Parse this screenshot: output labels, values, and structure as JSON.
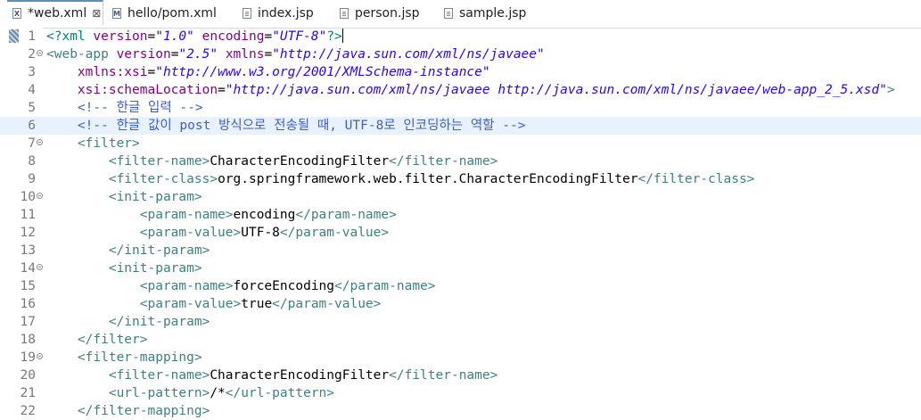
{
  "tabs": [
    {
      "label": "*web.xml",
      "icon": "xml-file-icon",
      "active": true,
      "close": "⊠"
    },
    {
      "label": "hello/pom.xml",
      "icon": "maven-file-icon",
      "active": false
    },
    {
      "label": "index.jsp",
      "icon": "jsp-file-icon",
      "active": false
    },
    {
      "label": "person.jsp",
      "icon": "jsp-file-icon",
      "active": false
    },
    {
      "label": "sample.jsp",
      "icon": "jsp-file-icon",
      "active": false
    }
  ],
  "icons": {
    "xml": "X",
    "maven": "M"
  },
  "lines": [
    {
      "n": "1",
      "p": [
        {
          "c": "decl",
          "t": "<?xml "
        },
        {
          "c": "attr",
          "t": "version"
        },
        {
          "c": "txt",
          "t": "="
        },
        {
          "c": "val",
          "t": "\"1.0\""
        },
        {
          "c": "txt",
          "t": " "
        },
        {
          "c": "attr",
          "t": "encoding"
        },
        {
          "c": "txt",
          "t": "="
        },
        {
          "c": "val",
          "t": "\"UTF-8\""
        },
        {
          "c": "decl",
          "t": "?>"
        }
      ]
    },
    {
      "n": "2",
      "p": [
        {
          "c": "tag",
          "t": "<web-app "
        },
        {
          "c": "attr",
          "t": "version"
        },
        {
          "c": "txt",
          "t": "="
        },
        {
          "c": "val",
          "t": "\"2.5\""
        },
        {
          "c": "txt",
          "t": " "
        },
        {
          "c": "attr",
          "t": "xmlns"
        },
        {
          "c": "txt",
          "t": "="
        },
        {
          "c": "val",
          "t": "\"http://java.sun.com/xml/ns/javaee\""
        }
      ]
    },
    {
      "n": "3",
      "p": [
        {
          "c": "txt",
          "t": "    "
        },
        {
          "c": "attr",
          "t": "xmlns:xsi"
        },
        {
          "c": "txt",
          "t": "="
        },
        {
          "c": "val",
          "t": "\"http://www.w3.org/2001/XMLSchema-instance\""
        }
      ]
    },
    {
      "n": "4",
      "p": [
        {
          "c": "txt",
          "t": "    "
        },
        {
          "c": "attr",
          "t": "xsi:schemaLocation"
        },
        {
          "c": "txt",
          "t": "="
        },
        {
          "c": "val",
          "t": "\"http://java.sun.com/xml/ns/javaee http://java.sun.com/xml/ns/javaee/web-app_2_5.xsd\""
        },
        {
          "c": "tag",
          "t": ">"
        }
      ]
    },
    {
      "n": "5",
      "p": [
        {
          "c": "cmt",
          "t": "    <!-- 한글 입력 -->"
        }
      ]
    },
    {
      "n": "6",
      "p": [
        {
          "c": "cmt",
          "t": "    <!-- 한글 값이 post 방식으로 전송될 때, UTF-8로 인코딩하는 역할 -->"
        }
      ]
    },
    {
      "n": "7",
      "p": [
        {
          "c": "tag",
          "t": "    <filter>"
        }
      ]
    },
    {
      "n": "8",
      "p": [
        {
          "c": "tag",
          "t": "        <filter-name>"
        },
        {
          "c": "txt",
          "t": "CharacterEncodingFilter"
        },
        {
          "c": "tag",
          "t": "</filter-name>"
        }
      ]
    },
    {
      "n": "9",
      "p": [
        {
          "c": "tag",
          "t": "        <filter-class>"
        },
        {
          "c": "txt",
          "t": "org.springframework.web.filter.CharacterEncodingFilter"
        },
        {
          "c": "tag",
          "t": "</filter-class>"
        }
      ]
    },
    {
      "n": "10",
      "p": [
        {
          "c": "tag",
          "t": "        <init-param>"
        }
      ]
    },
    {
      "n": "11",
      "p": [
        {
          "c": "tag",
          "t": "            <param-name>"
        },
        {
          "c": "txt",
          "t": "encoding"
        },
        {
          "c": "tag",
          "t": "</param-name>"
        }
      ]
    },
    {
      "n": "12",
      "p": [
        {
          "c": "tag",
          "t": "            <param-value>"
        },
        {
          "c": "txt",
          "t": "UTF-8"
        },
        {
          "c": "tag",
          "t": "</param-value>"
        }
      ]
    },
    {
      "n": "13",
      "p": [
        {
          "c": "tag",
          "t": "        </init-param>"
        }
      ]
    },
    {
      "n": "14",
      "p": [
        {
          "c": "tag",
          "t": "        <init-param>"
        }
      ]
    },
    {
      "n": "15",
      "p": [
        {
          "c": "tag",
          "t": "            <param-name>"
        },
        {
          "c": "txt",
          "t": "forceEncoding"
        },
        {
          "c": "tag",
          "t": "</param-name>"
        }
      ]
    },
    {
      "n": "16",
      "p": [
        {
          "c": "tag",
          "t": "            <param-value>"
        },
        {
          "c": "txt",
          "t": "true"
        },
        {
          "c": "tag",
          "t": "</param-value>"
        }
      ]
    },
    {
      "n": "17",
      "p": [
        {
          "c": "tag",
          "t": "        </init-param>"
        }
      ]
    },
    {
      "n": "18",
      "p": [
        {
          "c": "tag",
          "t": "    </filter>"
        }
      ]
    },
    {
      "n": "19",
      "p": [
        {
          "c": "tag",
          "t": "    <filter-mapping>"
        }
      ]
    },
    {
      "n": "20",
      "p": [
        {
          "c": "tag",
          "t": "        <filter-name>"
        },
        {
          "c": "txt",
          "t": "CharacterEncodingFilter"
        },
        {
          "c": "tag",
          "t": "</filter-name>"
        }
      ]
    },
    {
      "n": "21",
      "p": [
        {
          "c": "tag",
          "t": "        <url-pattern>"
        },
        {
          "c": "txt",
          "t": "/*"
        },
        {
          "c": "tag",
          "t": "</url-pattern>"
        }
      ]
    },
    {
      "n": "22",
      "p": [
        {
          "c": "tag",
          "t": "    </filter-mapping>"
        }
      ]
    }
  ],
  "foldable": [
    "2",
    "7",
    "10",
    "14",
    "19"
  ],
  "current_line": "6",
  "colors": {
    "tag": "#3f7f7f",
    "attribute": "#7f007f",
    "value": "#2a00ff",
    "comment": "#3f5fbf",
    "declaration": "#008080",
    "current_line_bg": "#e8f2fe",
    "active_tab_border": "#5a8ec4"
  }
}
